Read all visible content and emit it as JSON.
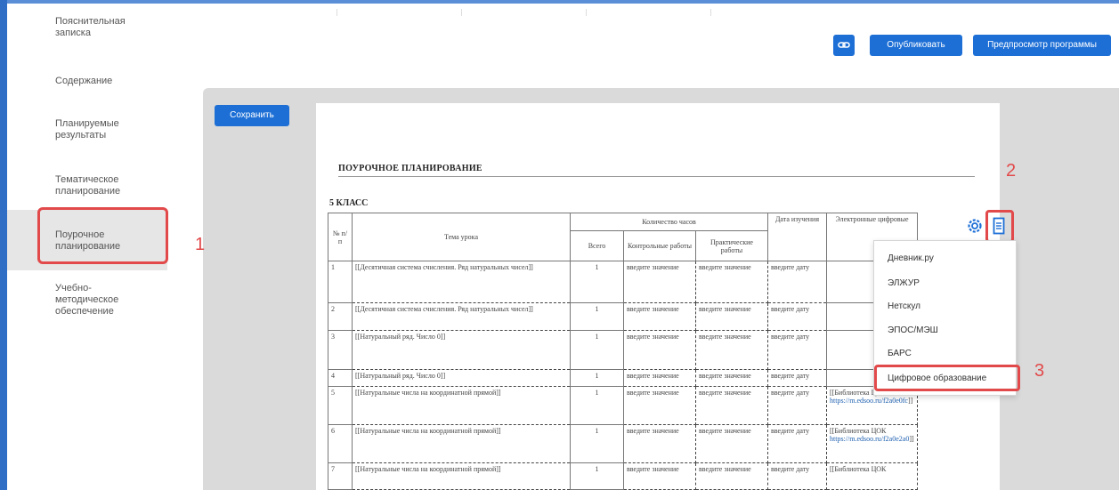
{
  "sidebar": {
    "items": [
      {
        "line1": "Пояснительная",
        "line2": "записка"
      },
      {
        "line1": "Содержание",
        "line2": ""
      },
      {
        "line1": "Планируемые",
        "line2": "результаты"
      },
      {
        "line1": "Тематическое",
        "line2": "планирование"
      },
      {
        "line1": "Поурочное",
        "line2": "планирование"
      },
      {
        "line1": "Учебно-",
        "line2": "методическое",
        "line3": "обеспечение"
      }
    ]
  },
  "toolbar": {
    "publish_label": "Опубликовать",
    "preview_label": "Предпросмотр программы",
    "save_label": "Сохранить"
  },
  "document": {
    "title": "ПОУРОЧНОЕ ПЛАНИРОВАНИЕ",
    "class_label": "5 КЛАСС",
    "headers": {
      "num": "№ п/п",
      "topic": "Тема урока",
      "hours": "Количество часов",
      "total": "Всего",
      "control": "Контрольные работы",
      "practical": "Практические работы",
      "date": "Дата изучения",
      "resources": "Электронные цифровые"
    },
    "placeholder_value": "введите значение",
    "placeholder_date": "введите дату",
    "rows": [
      {
        "num": "1",
        "topic": "[[Десятичная система счисления. Ряд натуральных чисел]]",
        "total": "1",
        "resource": ""
      },
      {
        "num": "2",
        "topic": "[[Десятичная система счисления. Ряд натуральных чисел]]",
        "total": "1",
        "resource": ""
      },
      {
        "num": "3",
        "topic": "[[Натуральный ряд. Число 0]]",
        "total": "1",
        "resource": ""
      },
      {
        "num": "4",
        "topic": "[[Натуральный ряд. Число 0]]",
        "total": "1",
        "resource": ""
      },
      {
        "num": "5",
        "topic": "[[Натуральные числа на координатной прямой]]",
        "total": "1",
        "resource_pre": "[[Библиотека ЦОК",
        "resource_link": "https://m.edsoo.ru/f2a0e0fc",
        "resource_post": "]]"
      },
      {
        "num": "6",
        "topic": "[[Натуральные числа на координатной прямой]]",
        "total": "1",
        "resource_pre": "[[Библиотека ЦОК",
        "resource_link": "https://m.edsoo.ru/f2a0e2a0",
        "resource_post": "]]"
      },
      {
        "num": "7",
        "topic": "[[Натуральные числа на координатной прямой]]",
        "total": "1",
        "resource_pre": "[[Библиотека ЦОК",
        "resource_link": "",
        "resource_post": ""
      }
    ]
  },
  "dropdown": {
    "items": [
      "Дневник.ру",
      "ЭЛЖУР",
      "Нетскул",
      "ЭПОС/МЭШ",
      "БАРС",
      "Цифровое образование"
    ]
  },
  "annotations": {
    "n1": "1",
    "n2": "2",
    "n3": "3"
  },
  "colors": {
    "accent": "#1d6fd6",
    "highlight": "#e2494a",
    "workspace": "#dadada"
  }
}
